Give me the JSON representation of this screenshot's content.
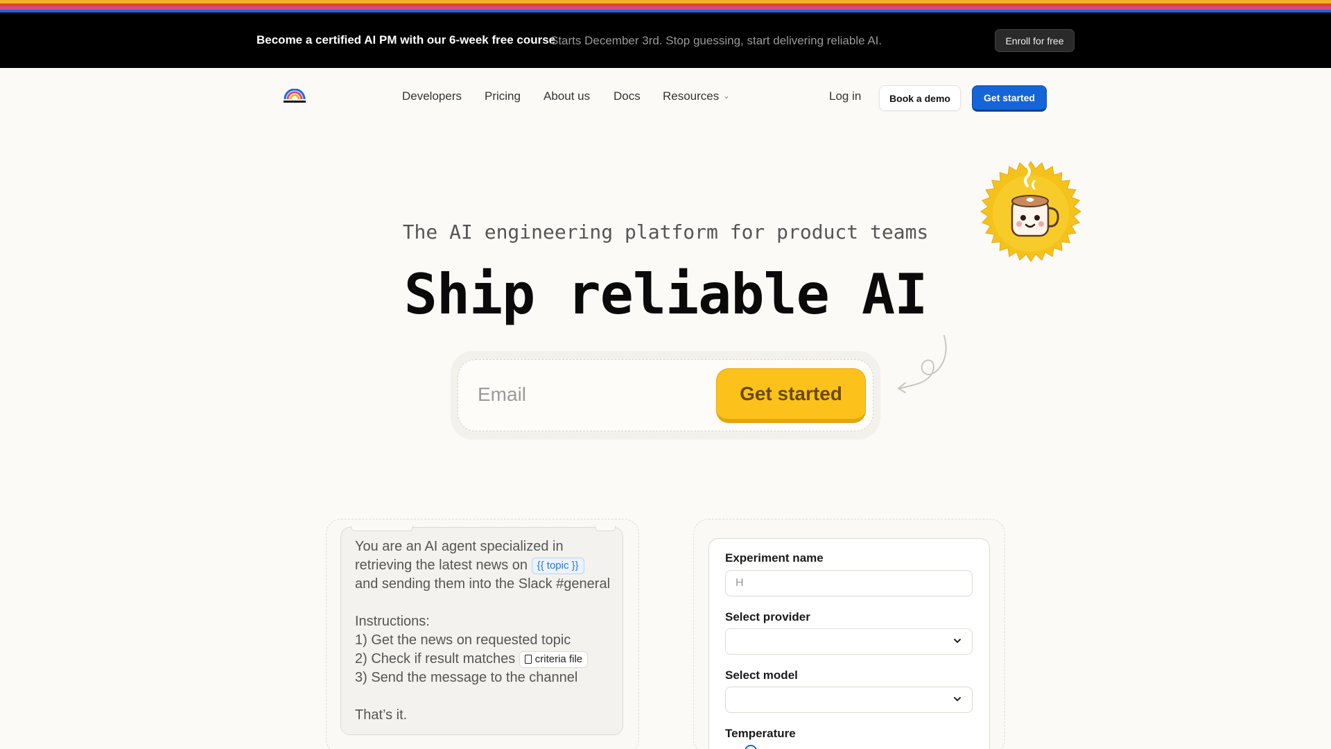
{
  "colors": {
    "rainbow": [
      "#f0b323",
      "#e2452c",
      "#d14b8a",
      "#1b6ad6"
    ],
    "promo_bg": "#000000",
    "primary_blue": "#1565d8",
    "cta_yellow": "#fcc21b"
  },
  "promo": {
    "title": "Become a certified AI PM with our 6-week free course",
    "subtitle": "Starts December 3rd. Stop guessing, start delivering reliable AI.",
    "cta": "Enroll for free"
  },
  "nav": {
    "logo_icon": "rainbow-logo",
    "links": [
      "Developers",
      "Pricing",
      "About us",
      "Docs",
      "Resources"
    ],
    "login": "Log in",
    "demo": "Book a demo",
    "get_started": "Get started"
  },
  "hero": {
    "badge_icon": "coffee-mug-mascot",
    "tagline": "The AI engineering platform for product teams",
    "headline": "Ship reliable AI",
    "email_placeholder": "Email",
    "cta": "Get started"
  },
  "prompt_card": {
    "line1": "You are an AI agent specialized in",
    "line2": "retrieving the latest news on",
    "topic_chip": "{{ topic }}",
    "line3": "and sending them into the Slack #general",
    "instructions": "Instructions:",
    "step1": "1) Get the news on requested topic",
    "step2": "2) Check if result matches",
    "file_chip": "criteria file",
    "step3": "3) Send the message to the channel",
    "closing": "That’s it."
  },
  "form_card": {
    "experiment_label": "Experiment name",
    "experiment_value": "H",
    "provider_label": "Select provider",
    "model_label": "Select model",
    "temperature_label": "Temperature"
  }
}
